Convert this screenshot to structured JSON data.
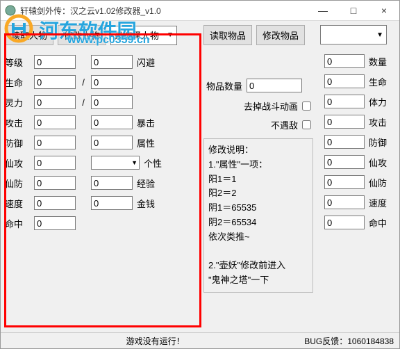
{
  "title": "轩辕剑外传：汉之云v1.02修改器_v1.0",
  "winbtns": {
    "min": "—",
    "max": "□",
    "close": "×"
  },
  "watermark": {
    "text": "河东软件园",
    "url": "www.pc0359.cn"
  },
  "left": {
    "btn_read": "读取人物",
    "btn_modify": "修改人物",
    "select_placeholder": "请选择人物",
    "rows": [
      {
        "l": "等级",
        "v1": "0",
        "sep": "",
        "v2": "0",
        "r": "闪避"
      },
      {
        "l": "生命",
        "v1": "0",
        "sep": "/",
        "v2": "0",
        "r": ""
      },
      {
        "l": "灵力",
        "v1": "0",
        "sep": "/",
        "v2": "0",
        "r": ""
      },
      {
        "l": "攻击",
        "v1": "0",
        "sep": "",
        "v2": "0",
        "r": "暴击"
      },
      {
        "l": "防御",
        "v1": "0",
        "sep": "",
        "v2": "0",
        "r": "属性"
      },
      {
        "l": "仙攻",
        "v1": "0",
        "sep": "",
        "v2": "",
        "r": "个性",
        "combo": true
      },
      {
        "l": "仙防",
        "v1": "0",
        "sep": "",
        "v2": "0",
        "r": "经验"
      },
      {
        "l": "速度",
        "v1": "0",
        "sep": "",
        "v2": "0",
        "r": "金钱"
      },
      {
        "l": "命中",
        "v1": "0",
        "sep": "",
        "v2": "",
        "r": ""
      }
    ]
  },
  "mid": {
    "btn_read": "读取物品",
    "btn_modify": "修改物品",
    "item_qty_label": "物品数量",
    "item_qty_value": "0",
    "chk1": "去掉战斗动画",
    "chk2": "不遇敌",
    "note_title": "修改说明：",
    "note_lines": [
      "1.\"属性\"一项：",
      "阳1＝1",
      "阳2＝2",
      "阴1＝65535",
      "阴2＝65534",
      "依次类推~",
      "",
      "2.\"壶妖\"修改前进入",
      "\"鬼神之塔\"一下"
    ]
  },
  "right": {
    "rows": [
      {
        "v": "0",
        "l": "数量"
      },
      {
        "v": "0",
        "l": "生命"
      },
      {
        "v": "0",
        "l": "体力"
      },
      {
        "v": "0",
        "l": "攻击"
      },
      {
        "v": "0",
        "l": "防御"
      },
      {
        "v": "0",
        "l": "仙攻"
      },
      {
        "v": "0",
        "l": "仙防"
      },
      {
        "v": "0",
        "l": "速度"
      },
      {
        "v": "0",
        "l": "命中"
      }
    ]
  },
  "status": {
    "s1": "游戏没有运行！",
    "s2": "BUG反馈：1060184838"
  }
}
